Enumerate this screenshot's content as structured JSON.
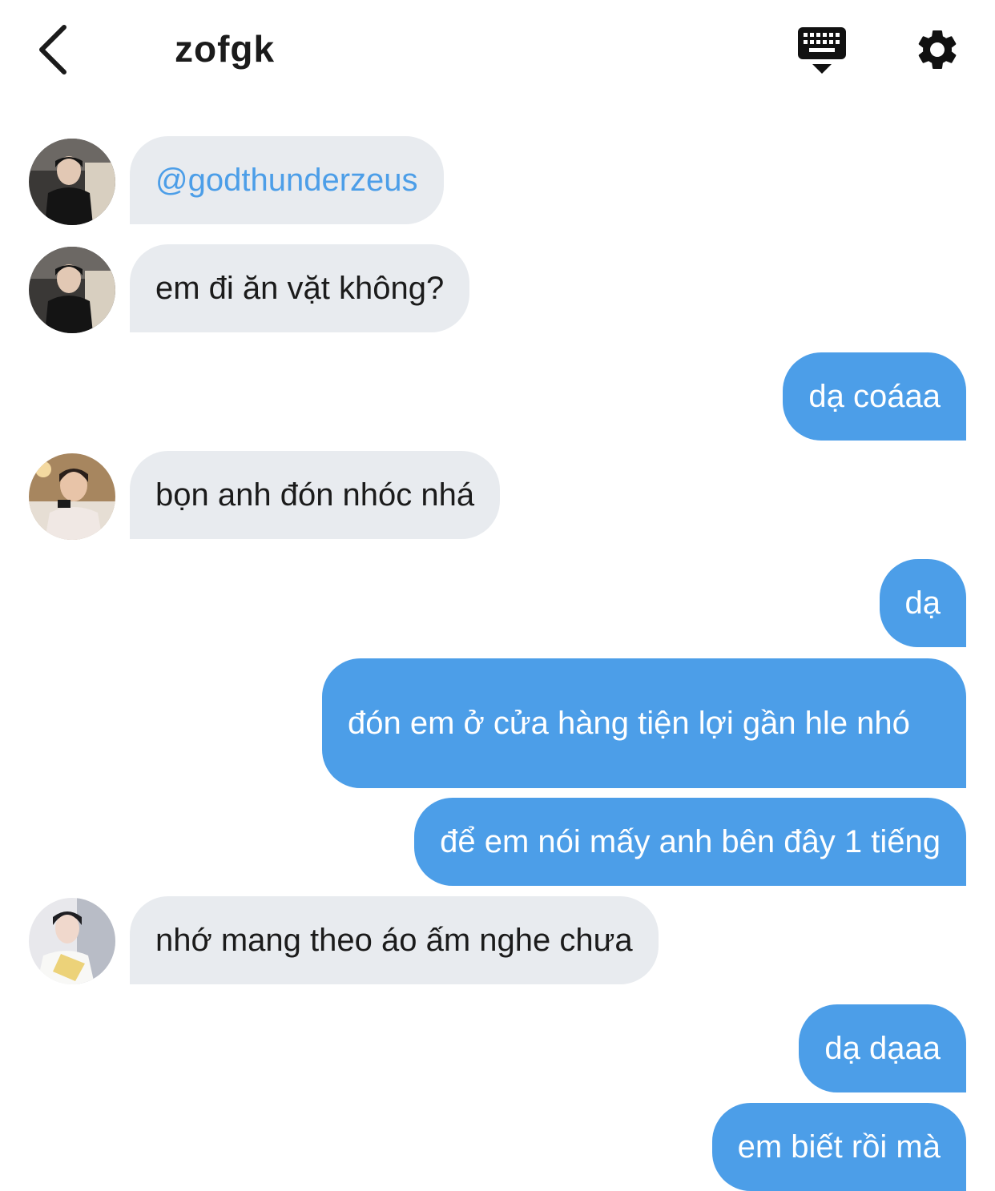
{
  "header": {
    "title": "zofgk",
    "back_icon": "chevron-left-icon",
    "keyboard_icon": "keyboard-icon",
    "settings_icon": "gear-icon"
  },
  "colors": {
    "outgoing_bubble": "#4c9ee8",
    "incoming_bubble": "#e8ebef",
    "mention": "#4c9ee8"
  },
  "messages": [
    {
      "direction": "in",
      "avatar": "avatar-1",
      "text": "@godthunderzeus"
    },
    {
      "direction": "in",
      "avatar": "avatar-1",
      "text": "em đi ăn vặt không?"
    },
    {
      "direction": "out",
      "text": "dạ coáaa"
    },
    {
      "direction": "in",
      "avatar": "avatar-2",
      "text": "bọn anh đón nhóc nhá"
    },
    {
      "direction": "out",
      "text": "dạ"
    },
    {
      "direction": "out",
      "text": "đón em ở cửa hàng tiện lợi gần hle nhó"
    },
    {
      "direction": "out",
      "text": "để em nói mấy anh bên đây 1 tiếng"
    },
    {
      "direction": "in",
      "avatar": "avatar-3",
      "text": "nhớ mang theo áo ấm nghe chưa"
    },
    {
      "direction": "out",
      "text": "dạ dạaa"
    },
    {
      "direction": "out",
      "text": "em biết rồi mà"
    }
  ]
}
